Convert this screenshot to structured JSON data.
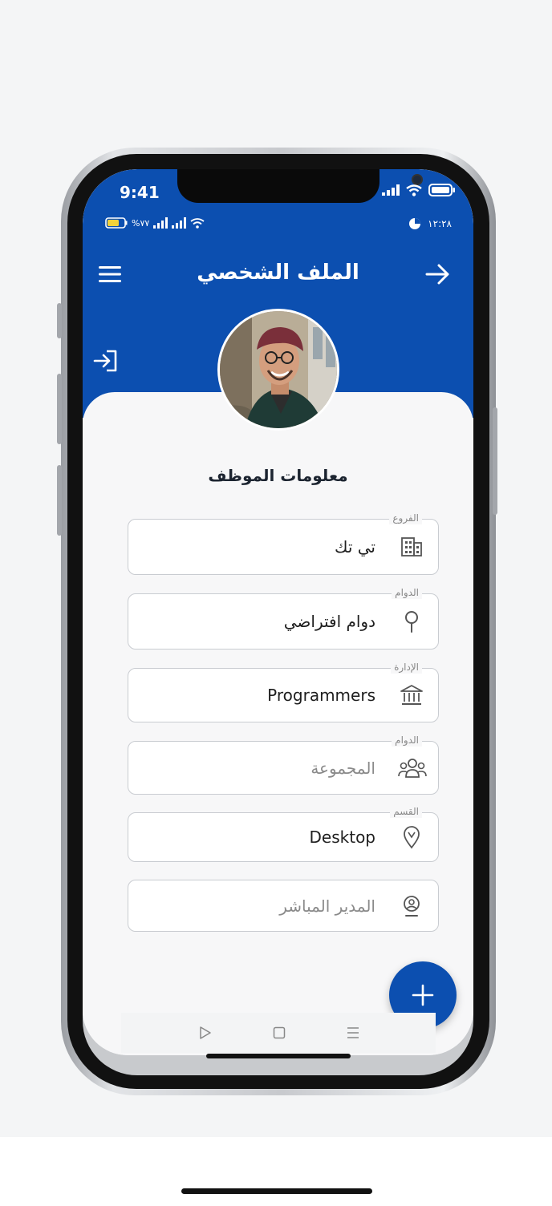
{
  "status_bar": {
    "time": "9:41"
  },
  "android_status": {
    "battery": "%٧٧",
    "clock": "١٢:٢٨"
  },
  "app_bar": {
    "title": "الملف الشخصي"
  },
  "section": {
    "title": "معلومات الموظف"
  },
  "fields": [
    {
      "label": "الفروع",
      "value": "تي تك",
      "icon": "building-icon",
      "placeholder": false
    },
    {
      "label": "الدوام",
      "value": "دوام افتراضي",
      "icon": "location-pin-icon",
      "placeholder": false
    },
    {
      "label": "الإدارة",
      "value": "Programmers",
      "icon": "institution-icon",
      "placeholder": false
    },
    {
      "label": "الدوام",
      "value": "المجموعة",
      "icon": "group-icon",
      "placeholder": true
    },
    {
      "label": "القسم",
      "value": "Desktop",
      "icon": "map-marker-icon",
      "placeholder": false
    },
    {
      "label": "",
      "value": "المدير المباشر",
      "icon": "manager-icon",
      "placeholder": true
    }
  ],
  "colors": {
    "primary": "#0c4fb0",
    "background": "#f7f7f8",
    "border": "#c9ccd1"
  }
}
